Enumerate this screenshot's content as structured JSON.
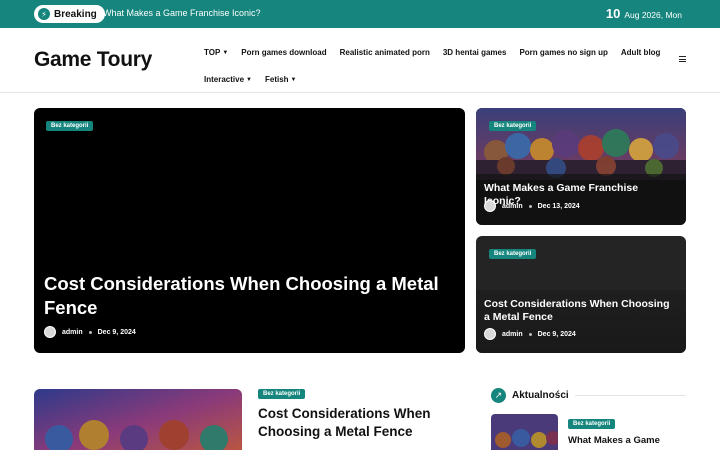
{
  "topbar": {
    "breaking_label": "Breaking",
    "breaking_headline": "What Makes a Game Franchise Iconic?",
    "date_day": "10",
    "date_rest": "Aug 2026, Mon"
  },
  "header": {
    "logo": "Game Toury",
    "nav": [
      {
        "label": "TOP",
        "dropdown": true
      },
      {
        "label": "Porn games download",
        "dropdown": false
      },
      {
        "label": "Realistic animated porn",
        "dropdown": false
      },
      {
        "label": "3D hentai games",
        "dropdown": false
      },
      {
        "label": "Porn games no sign up",
        "dropdown": false
      },
      {
        "label": "Adult blog",
        "dropdown": false
      },
      {
        "label": "Interactive",
        "dropdown": true
      },
      {
        "label": "Fetish",
        "dropdown": true
      }
    ]
  },
  "hero": {
    "category": "Bez kategorii",
    "title": "Cost Considerations When Choosing a Metal Fence",
    "author": "admin",
    "date": "Dec 9, 2024"
  },
  "side_cards": [
    {
      "category": "Bez kategorii",
      "title": "What Makes a Game Franchise Iconic?",
      "author": "admin",
      "date": "Dec 13, 2024"
    },
    {
      "category": "Bez kategorii",
      "title": "Cost Considerations When Choosing a Metal Fence",
      "author": "admin",
      "date": "Dec 9, 2024"
    }
  ],
  "latest_post": {
    "category": "Bez kategorii",
    "title": "Cost Considerations When Choosing a Metal Fence"
  },
  "aktualnosci": {
    "heading": "Aktualności",
    "items": [
      {
        "category": "Bez kategorii",
        "title": "What Makes a Game"
      }
    ]
  },
  "colors": {
    "accent": "#15857d",
    "hero_bg": "#000000"
  }
}
